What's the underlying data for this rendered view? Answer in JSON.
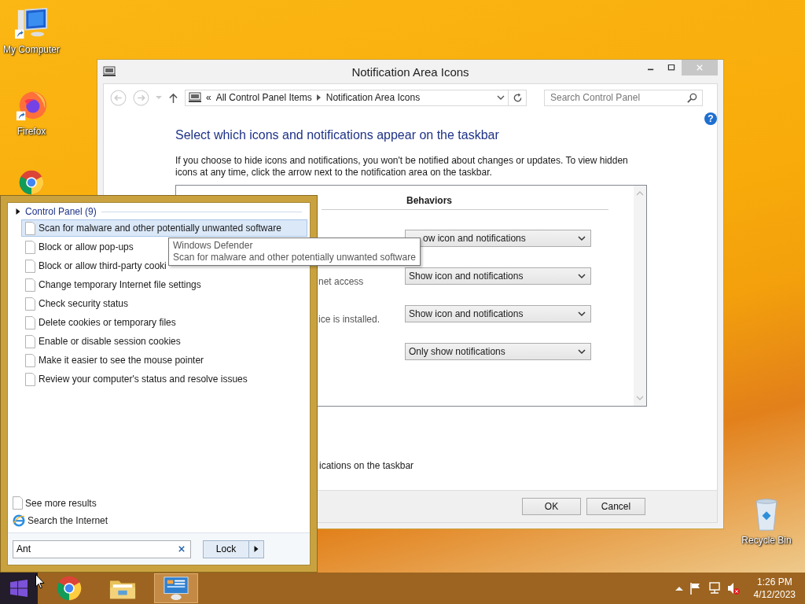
{
  "desktop_icons": [
    {
      "kind": "computer",
      "label": "My Computer"
    },
    {
      "kind": "firefox",
      "label": "Firefox"
    },
    {
      "kind": "chrome"
    }
  ],
  "recycle_bin": {
    "label": "Recycle Bin"
  },
  "window": {
    "title": "Notification Area Icons",
    "breadcrumb": {
      "overflow": "«",
      "items": [
        "All Control Panel Items",
        "Notification Area Icons"
      ]
    },
    "search": {
      "placeholder": "Search Control Panel"
    },
    "help": "?",
    "heading": "Select which icons and notifications appear on the taskbar",
    "description": "If you choose to hide icons and notifications, you won't be notified about changes or updates. To view hidden icons at any time, click the arrow next to the notification area on the taskbar.",
    "table": {
      "header": "Behaviors",
      "rows": [
        {
          "behavior": "ow icon and notifications"
        },
        {
          "label": "net access",
          "behavior": "Show icon and notifications"
        },
        {
          "label": "ice is installed.",
          "behavior": "Show icon and notifications"
        },
        {
          "behavior": "Only show notifications"
        }
      ]
    },
    "option_text": "ications on the taskbar",
    "buttons": [
      "OK",
      "Cancel"
    ]
  },
  "start_menu": {
    "group": "Control Panel (9)",
    "items": [
      {
        "label": "Scan for malware and other potentially unwanted software",
        "selected": true
      },
      {
        "label": "Block or allow pop-ups",
        "selected": false
      },
      {
        "label": "Block or allow third-party cooki",
        "selected": false
      },
      {
        "label": "Change temporary Internet file settings",
        "selected": false
      },
      {
        "label": "Check security status",
        "selected": false
      },
      {
        "label": "Delete cookies or temporary files",
        "selected": false
      },
      {
        "label": "Enable or disable session cookies",
        "selected": false
      },
      {
        "label": "Make it easier to see the mouse pointer",
        "selected": false
      },
      {
        "label": "Review your computer's status and resolve issues",
        "selected": false
      }
    ],
    "footer": [
      {
        "kind": "page",
        "label": "See more results"
      },
      {
        "kind": "browser",
        "label": "Search the Internet"
      }
    ],
    "search": {
      "value": "Ant"
    },
    "power_button": "Lock"
  },
  "tooltip": {
    "title": "Windows Defender",
    "text": "Scan for malware and other potentially unwanted software"
  },
  "taskbar": {
    "apps": [
      {
        "kind": "chrome",
        "selected": false
      },
      {
        "kind": "folder",
        "selected": false
      },
      {
        "kind": "control-panel",
        "selected": true
      }
    ],
    "time": "1:26 PM",
    "date": "4/12/2023"
  }
}
